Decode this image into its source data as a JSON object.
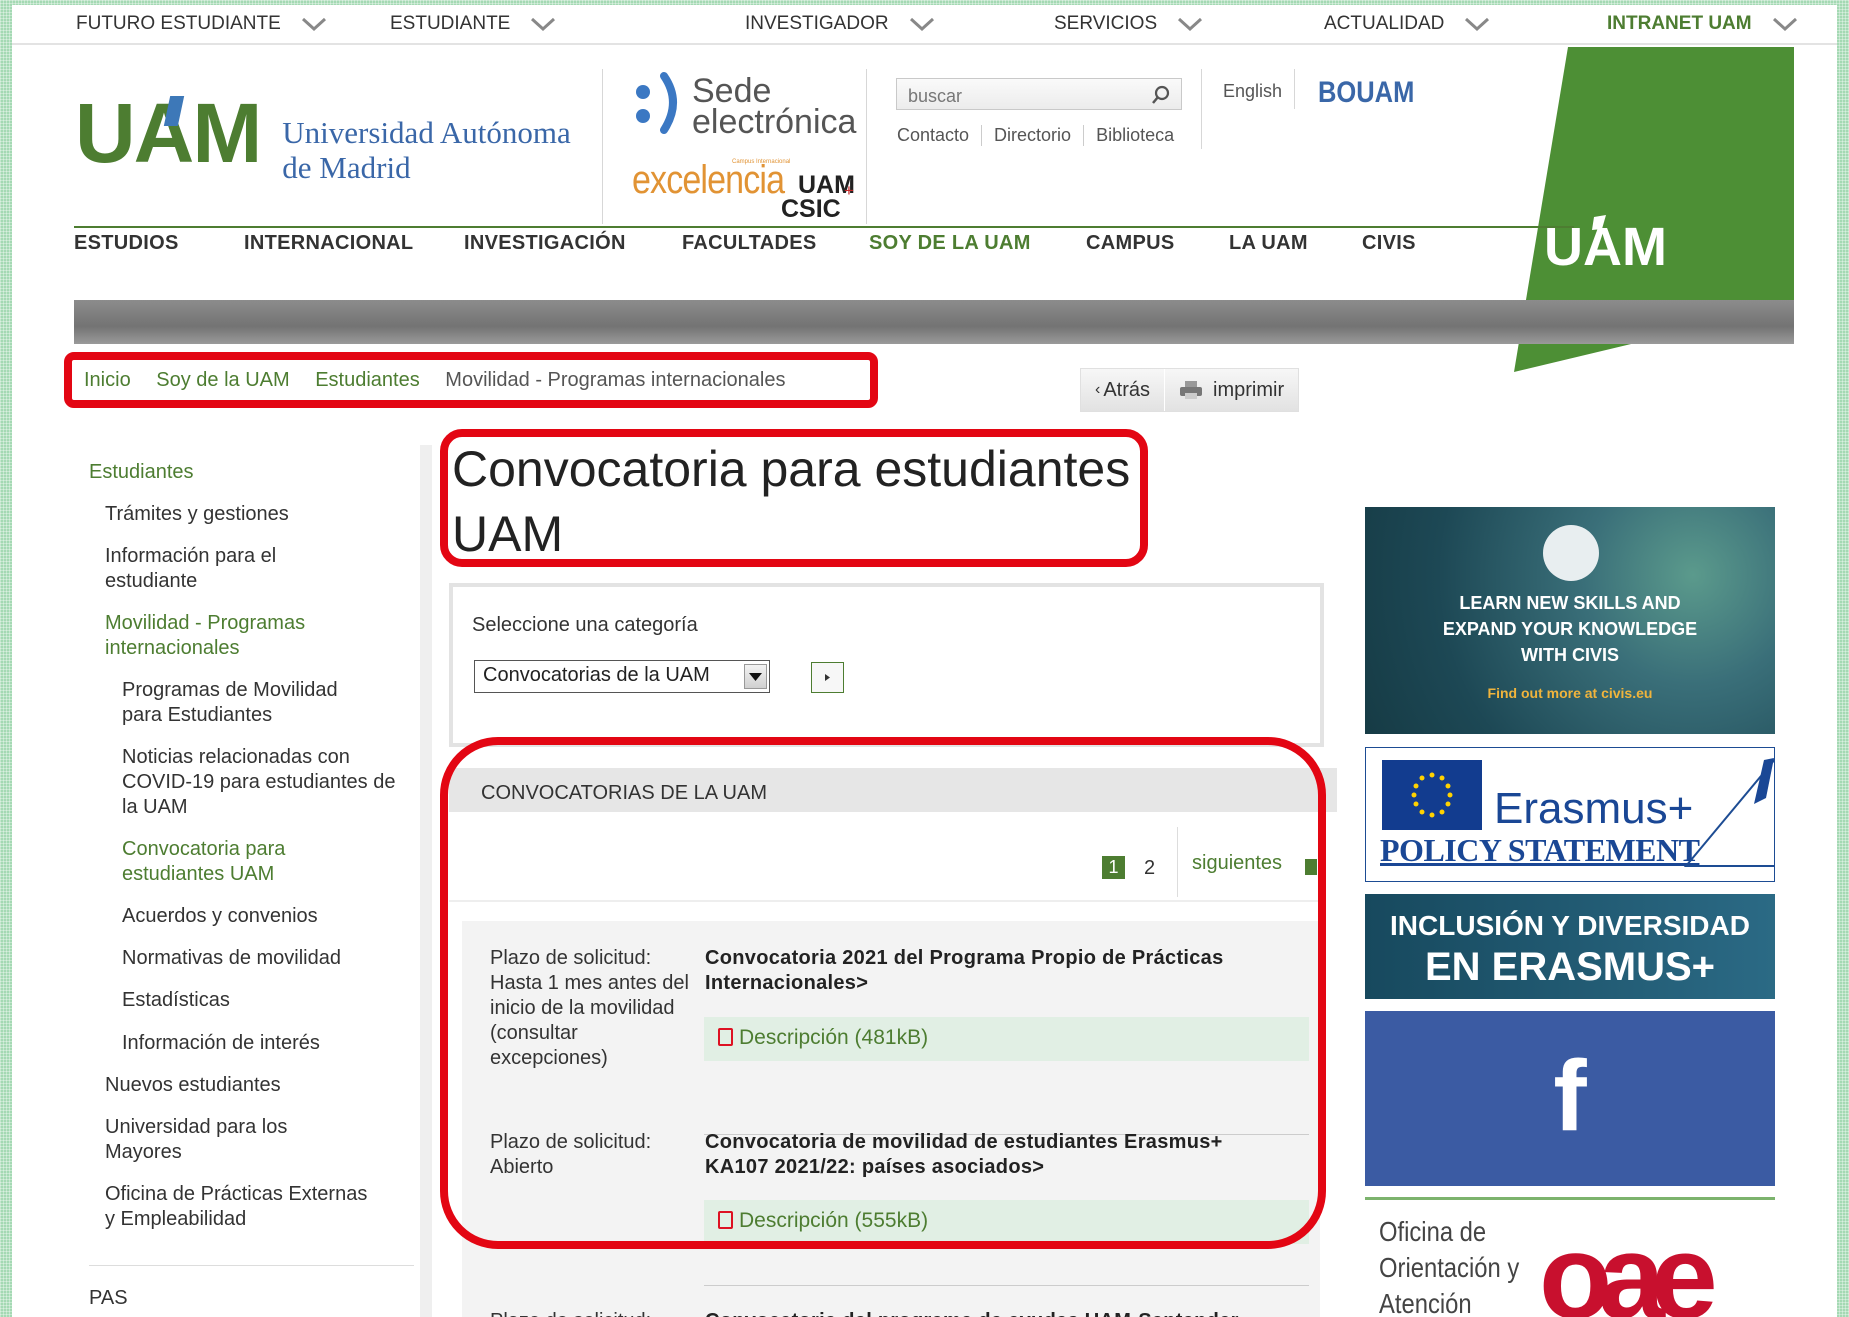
{
  "top_nav": [
    {
      "label": "FUTURO ESTUDIANTE"
    },
    {
      "label": "ESTUDIANTE"
    },
    {
      "label": "INVESTIGADOR"
    },
    {
      "label": "SERVICIOS"
    },
    {
      "label": "ACTUALIDAD"
    },
    {
      "label": "INTRANET UAM"
    }
  ],
  "header": {
    "logo_text": "UAM",
    "university_line1": "Universidad Autónoma",
    "university_line2": "de Madrid",
    "sede_line1": "Sede",
    "sede_line2": "electrónica",
    "excelencia": "excelencia",
    "excelencia_uam": "UAM",
    "excelencia_csic": "CSIC",
    "excelencia_small": "Campus Internacional",
    "search_placeholder": "buscar",
    "quick_links": [
      "Contacto",
      "Directorio",
      "Biblioteca"
    ],
    "lang": "English",
    "bouam": "BOUAM",
    "side_logo": "UAM"
  },
  "main_nav": [
    {
      "label": "ESTUDIOS"
    },
    {
      "label": "INTERNACIONAL"
    },
    {
      "label": "INVESTIGACIÓN"
    },
    {
      "label": "FACULTADES"
    },
    {
      "label": "SOY DE LA UAM"
    },
    {
      "label": "CAMPUS"
    },
    {
      "label": "LA UAM"
    },
    {
      "label": "CIVIS"
    }
  ],
  "breadcrumb": [
    "Inicio",
    "Soy de la UAM",
    "Estudiantes",
    "Movilidad - Programas internacionales"
  ],
  "tools": {
    "back": "Atrás",
    "print": "imprimir"
  },
  "sidebar": {
    "section": "Estudiantes",
    "items": [
      {
        "label": "Trámites y gestiones"
      },
      {
        "label": "Información para el estudiante"
      },
      {
        "label": "Movilidad - Programas internacionales"
      },
      {
        "label": "Programas de Movilidad para Estudiantes"
      },
      {
        "label": "Noticias relacionadas con COVID-19 para estudiantes de la UAM"
      },
      {
        "label": "Convocatoria para estudiantes UAM"
      },
      {
        "label": "Acuerdos y convenios"
      },
      {
        "label": "Normativas de movilidad"
      },
      {
        "label": "Estadísticas"
      },
      {
        "label": "Información de interés"
      },
      {
        "label": "Nuevos estudiantes"
      },
      {
        "label": "Universidad para los Mayores"
      },
      {
        "label": "Oficina de Prácticas Externas y Empleabilidad"
      }
    ],
    "pas": "PAS"
  },
  "page_title": "Convocatoria para estudiantes UAM",
  "category": {
    "label": "Seleccione una categoría",
    "selected": "Convocatorias de la UAM"
  },
  "section_header": "CONVOCATORIAS DE LA UAM",
  "pager": {
    "pages": [
      "1",
      "2"
    ],
    "next": "siguientes"
  },
  "calls": [
    {
      "plazo": "Plazo de solicitud: Hasta 1 mes antes del inicio de la movilidad (consultar excepciones)",
      "title": "Convocatoria 2021 del Programa Propio de Prácticas Internacionales>",
      "link": "Descripción (481kB)"
    },
    {
      "plazo": "Plazo de solicitud: Abierto",
      "title": "Convocatoria de movilidad de estudiantes Erasmus+ KA107 2021/22: países asociados>",
      "link": "Descripción (555kB)"
    },
    {
      "plazo": "Plazo de solicitud:",
      "title": "Convocatoria del programa de ayudas UAM-Santander"
    }
  ],
  "banners": {
    "civis_line": "LEARN NEW SKILLS AND EXPAND YOUR KNOWLEDGE WITH CIVIS",
    "civis_link": "Find out more at civis.eu",
    "erasmus": "Erasmus+",
    "erasmus_policy": "POLICY STATEMENT",
    "inclusion_line1": "INCLUSIÓN Y DIVERSIDAD",
    "inclusion_line2": "EN ERASMUS+",
    "facebook": "f",
    "oae_text": "Oficina de Orientación y Atención",
    "oae_logo": "oae"
  },
  "colors": {
    "brand_green": "#4d7d31",
    "brand_blue": "#3a67a8",
    "highlight_red": "#e30613"
  }
}
